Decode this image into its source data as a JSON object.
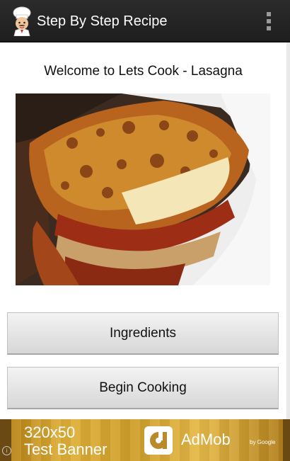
{
  "action_bar": {
    "title": "Step By Step Recipe",
    "app_icon": "chef-icon",
    "overflow_icon": "overflow-menu-icon"
  },
  "main": {
    "welcome_text": "Welcome to Lets Cook - Lasagna",
    "image_subject": "lasagna-photo",
    "buttons": {
      "ingredients": "Ingredients",
      "begin_cooking": "Begin Cooking"
    }
  },
  "ad": {
    "line1": "320x50",
    "line2": "Test Banner",
    "brand": "AdMob",
    "by": "by Google",
    "info_icon": "i"
  },
  "colors": {
    "action_bar": "#222222",
    "ad_gold": "#d9a934",
    "button_face": "#e6e6e6"
  }
}
